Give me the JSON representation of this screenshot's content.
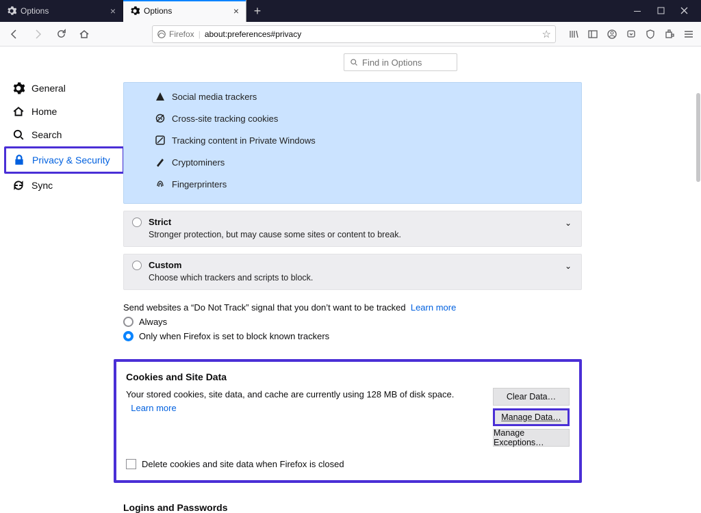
{
  "window": {
    "app": "Firefox"
  },
  "tabs": [
    {
      "title": "Options",
      "active": false
    },
    {
      "title": "Options",
      "active": true
    }
  ],
  "url": {
    "identity_label": "Firefox",
    "address": "about:preferences#privacy"
  },
  "search": {
    "placeholder": "Find in Options"
  },
  "sidebar": {
    "items": [
      {
        "label": "General"
      },
      {
        "label": "Home"
      },
      {
        "label": "Search"
      },
      {
        "label": "Privacy & Security"
      },
      {
        "label": "Sync"
      }
    ]
  },
  "protection": {
    "items": [
      "Social media trackers",
      "Cross-site tracking cookies",
      "Tracking content in Private Windows",
      "Cryptominers",
      "Fingerprinters"
    ]
  },
  "levels": {
    "strict": {
      "title": "Strict",
      "desc": "Stronger protection, but may cause some sites or content to break."
    },
    "custom": {
      "title": "Custom",
      "desc": "Choose which trackers and scripts to block."
    }
  },
  "dnt": {
    "text": "Send websites a “Do Not Track” signal that you don’t want to be tracked",
    "learn": "Learn more",
    "always": "Always",
    "onlywhen": "Only when Firefox is set to block known trackers"
  },
  "cookies": {
    "title": "Cookies and Site Data",
    "body1": "Your stored cookies, site data, and cache are currently using 128 MB of disk space.",
    "learn": "Learn more",
    "delete": "Delete cookies and site data when Firefox is closed",
    "buttons": {
      "clear": "Clear Data…",
      "manage": "Manage Data…",
      "exceptions": "Manage Exceptions…"
    }
  },
  "logins": {
    "title": "Logins and Passwords"
  }
}
